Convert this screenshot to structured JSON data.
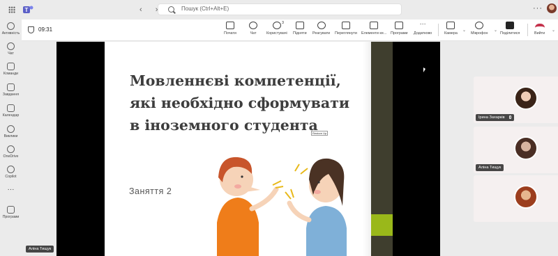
{
  "titlebar": {
    "search_placeholder": "Пошук (Ctrl+Alt+E)",
    "more": "···",
    "icons": [
      "app-grid-icon",
      "teams-logo",
      "back-arrow-icon",
      "forward-arrow-icon",
      "search-icon",
      "more-icon",
      "user-avatar"
    ]
  },
  "rail": {
    "items": [
      {
        "label": "Активність",
        "icon": "bell-icon"
      },
      {
        "label": "Чат",
        "icon": "chat-icon"
      },
      {
        "label": "Команди",
        "icon": "teams-icon"
      },
      {
        "label": "Завдання",
        "icon": "assignments-icon"
      },
      {
        "label": "Календар",
        "icon": "calendar-icon"
      },
      {
        "label": "Виклики",
        "icon": "phone-icon"
      },
      {
        "label": "OneDrive",
        "icon": "cloud-icon"
      },
      {
        "label": "Copilot",
        "icon": "copilot-icon"
      },
      {
        "label": "···",
        "icon": "more-icon"
      },
      {
        "label": "Програми",
        "icon": "add-apps-icon"
      }
    ]
  },
  "meeting": {
    "timer": "09:31",
    "toolbar": {
      "start": "Почати",
      "chat": "Чат",
      "people": "Користувачі",
      "people_count": "3",
      "raise": "Підняти",
      "react": "Реагувати",
      "rooms": "Переглянути",
      "elements": "Елементи ке...",
      "apps": "Програми",
      "more": "Додатково",
      "camera": "Камера",
      "mic": "Мікрофон",
      "share": "Поділитися",
      "leave": "Вийти"
    }
  },
  "presentation": {
    "presenter_name": "Аліна Тищук",
    "slide_title_lines": [
      "Мовленнєві компетенції,",
      "які необхідно сформувати",
      "в іноземного студента"
    ],
    "lesson": "Заняття 2",
    "restore_tag": "Restore Up"
  },
  "participants": [
    {
      "name": "Ірина Захарків",
      "muted": true
    },
    {
      "name": "Аліна Тищук",
      "muted": false
    },
    {
      "name": "",
      "muted": false
    }
  ],
  "colors": {
    "olive": "#3f3e2e",
    "green": "#9ab81a",
    "leave_red": "#c4314b"
  }
}
